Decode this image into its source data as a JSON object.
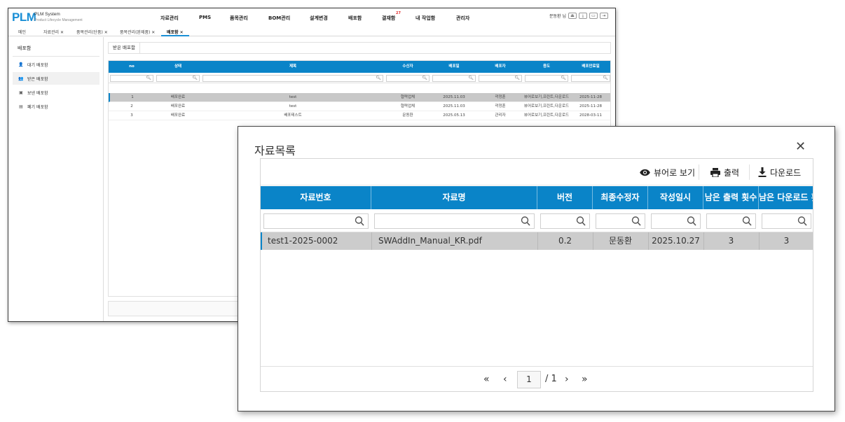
{
  "app": {
    "logo": "PLM",
    "subtitle_line1": "PLM System",
    "subtitle_line2": "Product Lifecycle Management",
    "nav": [
      "자료관리",
      "PMS",
      "품목관리",
      "BOM관리",
      "설계변경",
      "배포함",
      "결재함",
      "내 작업함",
      "관리자"
    ],
    "approval_badge": "27",
    "user_name": "문동환 님",
    "tabs": [
      "메인",
      "자료관리 ✕",
      "품목관리(단품) ✕",
      "품목관리(완제품) ✕",
      "배포함 ✕"
    ],
    "sidebar": {
      "title": "배포함",
      "items": [
        {
          "label": "대기 배포함",
          "icon": "person-icon"
        },
        {
          "label": "받은 배포함",
          "icon": "people-icon"
        },
        {
          "label": "보낸 배포함",
          "icon": "outbox-icon"
        },
        {
          "label": "폐기 배포함",
          "icon": "trash-box-icon"
        }
      ]
    },
    "content_tab": "받은 배포함",
    "table": {
      "headers": [
        "no",
        "상태",
        "제목",
        "수신자",
        "배포일",
        "배포자",
        "용도",
        "배포만료일"
      ],
      "rows": [
        [
          "1",
          "배포완료",
          "test",
          "협력업체",
          "2025.11.03",
          "곽정훈",
          "뷰어로보기,프린트,다운로드",
          "2025-11-28"
        ],
        [
          "2",
          "배포완료",
          "test",
          "협력업체",
          "2025.11.03",
          "곽정훈",
          "뷰어로보기,프린트,다운로드",
          "2025-11-28"
        ],
        [
          "3",
          "배포완료",
          "배포테스트",
          "문동환",
          "2025.05.13",
          "관리자",
          "뷰어로보기,프린트,다운로드",
          "2028-03-11"
        ]
      ]
    }
  },
  "modal": {
    "title": "자료목록",
    "close": "✕",
    "toolbar": {
      "viewer": "뷰어로 보기",
      "print": "출력",
      "download": "다운로드"
    },
    "table": {
      "headers": [
        "자료번호",
        "자료명",
        "버전",
        "최종수정자",
        "작성일시",
        "남은 출력 횟수",
        "남은 다운로드 횟수"
      ],
      "rows": [
        [
          "test1-2025-0002",
          "SWAddIn_Manual_KR.pdf",
          "0.2",
          "문동환",
          "2025.10.27",
          "3",
          "3"
        ]
      ]
    },
    "pagination": {
      "first": "«",
      "prev": "‹",
      "current": "1",
      "total": "/ 1",
      "next": "›",
      "last": "»"
    }
  },
  "colors": {
    "accent": "#0a84c8",
    "logo": "#1a8fd6",
    "badge": "#e02b2b",
    "selected_row": "#cccccc"
  }
}
